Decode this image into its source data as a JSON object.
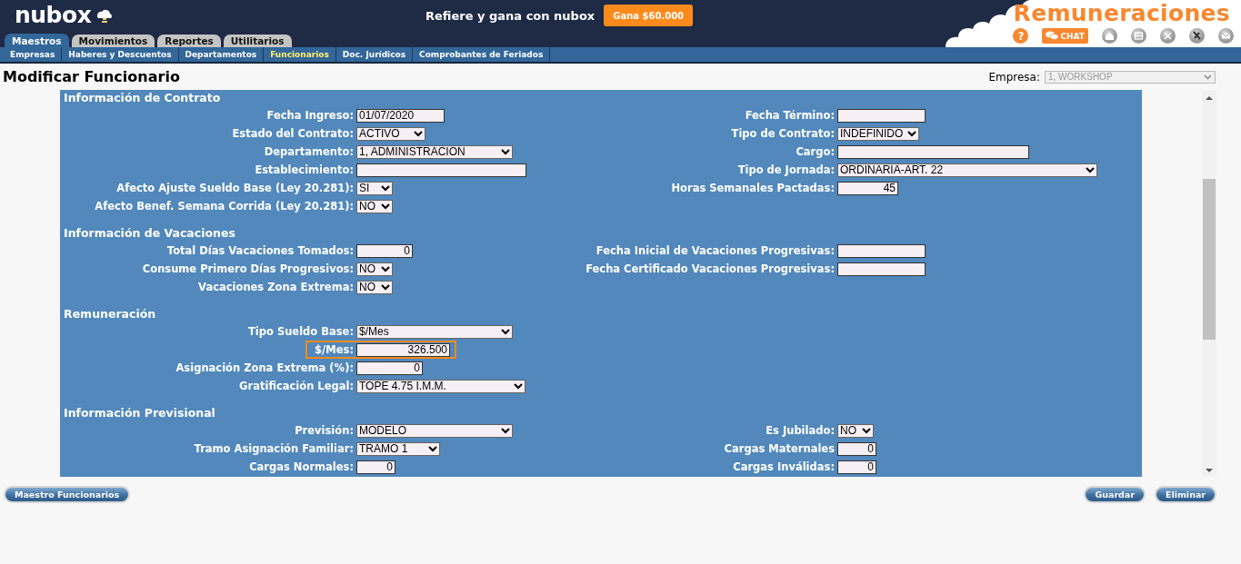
{
  "header": {
    "logo": "nubox",
    "promo_text": "Refiere y gana con nubox",
    "promo_button": "Gana $60.000",
    "product": "Remuneraciones",
    "chat_button": "CHAT",
    "help_icon": "?"
  },
  "tabs": [
    {
      "label": "Maestros",
      "selected": true
    },
    {
      "label": "Movimientos",
      "selected": false
    },
    {
      "label": "Reportes",
      "selected": false
    },
    {
      "label": "Utilitarios",
      "selected": false
    }
  ],
  "subnav": [
    {
      "label": "Empresas",
      "selected": false
    },
    {
      "label": "Haberes y Descuentos",
      "selected": false
    },
    {
      "label": "Departamentos",
      "selected": false
    },
    {
      "label": "Funcionarios",
      "selected": true
    },
    {
      "label": "Doc. Jurídicos",
      "selected": false
    },
    {
      "label": "Comprobantes de Feriados",
      "selected": false
    }
  ],
  "page_title": "Modificar Funcionario",
  "company": {
    "label": "Empresa:",
    "value": "1, WORKSHOP",
    "disabled": true
  },
  "sections": [
    {
      "title": "Información de Contrato",
      "rows": [
        {
          "left": {
            "label": "Fecha Ingreso:",
            "kind": "input",
            "value": "01/07/2020"
          },
          "right": {
            "label": "Fecha Término:",
            "kind": "input"
          }
        },
        {
          "left": {
            "label": "Estado del Contrato:",
            "kind": "select",
            "value": "ACTIVO"
          },
          "right": {
            "label": "Tipo de Contrato:",
            "kind": "select",
            "value": "INDEFINIDO"
          }
        },
        {
          "left": {
            "label": "Departamento:",
            "kind": "select",
            "value": "1, ADMINISTRACION"
          },
          "right": {
            "label": "Cargo:",
            "kind": "input"
          }
        },
        {
          "left": {
            "label": "Establecimiento:",
            "kind": "input"
          },
          "right": {
            "label": "Tipo de Jornada:",
            "kind": "select",
            "value": "ORDINARIA-ART. 22"
          }
        },
        {
          "left": {
            "label": "Afecto Ajuste Sueldo Base (Ley 20.281):",
            "kind": "select",
            "value": "SI"
          },
          "right": {
            "label": "Horas Semanales Pactadas:",
            "kind": "number",
            "value": "45"
          }
        },
        {
          "left": {
            "label": "Afecto Benef. Semana Corrida (Ley 20.281):",
            "kind": "select",
            "value": "NO"
          }
        }
      ]
    },
    {
      "title": "Información de Vacaciones",
      "rows": [
        {
          "left": {
            "label": "Total Días Vacaciones Tomados:",
            "kind": "number",
            "value": "0"
          },
          "right": {
            "label": "Fecha Inicial de Vacaciones Progresivas:",
            "kind": "input"
          }
        },
        {
          "left": {
            "label": "Consume Primero Días Progresivos:",
            "kind": "select",
            "value": "NO"
          },
          "right": {
            "label": "Fecha Certificado Vacaciones Progresivas:",
            "kind": "input"
          }
        },
        {
          "left": {
            "label": "Vacaciones Zona Extrema:",
            "kind": "select",
            "value": "NO"
          }
        }
      ]
    },
    {
      "title": "Remuneración",
      "rows": [
        {
          "left": {
            "label": "Tipo Sueldo Base:",
            "kind": "select",
            "value": "$/Mes"
          }
        },
        {
          "left": {
            "label": "$/Mes:",
            "kind": "number",
            "value": "326.500",
            "highlighted": true
          }
        },
        {
          "left": {
            "label": "Asignación Zona Extrema (%):",
            "kind": "number",
            "value": "0"
          }
        },
        {
          "left": {
            "label": "Gratificación Legal:",
            "kind": "select",
            "value": "TOPE 4.75 I.M.M."
          }
        }
      ]
    },
    {
      "title": "Información Previsional",
      "rows": [
        {
          "left": {
            "label": "Previsión:",
            "kind": "select",
            "value": "MODELO"
          },
          "right": {
            "label": "Es Jubilado:",
            "kind": "select",
            "value": "NO"
          }
        },
        {
          "left": {
            "label": "Tramo Asignación Familiar:",
            "kind": "select",
            "value": "TRAMO 1"
          },
          "right": {
            "label": "Cargas Maternales",
            "kind": "number",
            "value": "0"
          }
        },
        {
          "left": {
            "label": "Cargas Normales:",
            "kind": "number",
            "value": "0"
          },
          "right": {
            "label": "Cargas Inválidas:",
            "kind": "number",
            "value": "0"
          }
        }
      ]
    }
  ],
  "footer": {
    "left_buttons": [
      "Maestro Funcionarios"
    ],
    "right_buttons": [
      "Guardar",
      "Eliminar"
    ]
  }
}
